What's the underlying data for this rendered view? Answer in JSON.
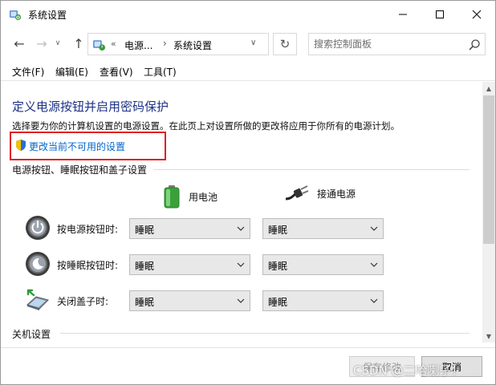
{
  "window": {
    "title": "系统设置",
    "controls": {
      "minimize": "—",
      "maximize": "☐",
      "close": "✕"
    }
  },
  "nav": {
    "back": "←",
    "forward": "→",
    "recent": "∨",
    "up": "↑",
    "address": {
      "sep1": "«",
      "crumb1": "电源...",
      "sep2": "›",
      "crumb2": "系统设置",
      "dropdown": "∨"
    },
    "refresh": "↻",
    "search": {
      "placeholder": "搜索控制面板"
    }
  },
  "menu": [
    "文件(F)",
    "编辑(E)",
    "查看(V)",
    "工具(T)"
  ],
  "page": {
    "title": "定义电源按钮并启用密码保护",
    "description": "选择要为你的计算机设置的电源设置。在此页上对设置所做的更改将应用于你所有的电源计划。",
    "change_link": "更改当前不可用的设置",
    "section1": "电源按钮、睡眠按钮和盖子设置",
    "col_battery": "用电池",
    "col_plugged": "接通电源",
    "rows": [
      {
        "label": "按电源按钮时:",
        "battery": "睡眠",
        "plugged": "睡眠"
      },
      {
        "label": "按睡眠按钮时:",
        "battery": "睡眠",
        "plugged": "睡眠"
      },
      {
        "label": "关闭盖子时:",
        "battery": "睡眠",
        "plugged": "睡眠"
      }
    ],
    "section2": "关机设置"
  },
  "footer": {
    "save": "保存修改",
    "cancel": "取消"
  },
  "watermark": "CSDN @二哈喇子！",
  "colors": {
    "title": "#1e3287",
    "link": "#0066cc",
    "highlight_box": "#e0201f"
  }
}
